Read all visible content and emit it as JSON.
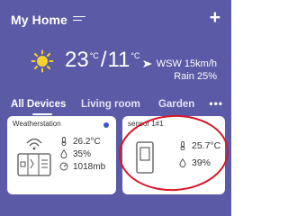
{
  "header": {
    "title": "My Home"
  },
  "weather": {
    "temperature": "23",
    "temp_unit": "°C",
    "temperature_2": "11",
    "temp_unit_2": "°C",
    "wind": "WSW 15km/h",
    "rain": "Rain 25%"
  },
  "tabs": [
    {
      "label": "All Devices"
    },
    {
      "label": "Living room"
    },
    {
      "label": "Garden"
    }
  ],
  "devices": [
    {
      "name": "Weatherstation",
      "temperature": "26.2°C",
      "humidity": "35%",
      "pressure": "1018mb",
      "status_color": "#3a56c9"
    },
    {
      "name": "sensor 1#1",
      "temperature": "25.7°C",
      "humidity": "39%"
    }
  ],
  "colors": {
    "background": "#5a5aa6",
    "card": "#ffffff",
    "highlight": "#d9162a",
    "sun": "#f6d22a"
  },
  "icons": [
    "menu-icon",
    "plus-icon",
    "sun-icon",
    "navigation-arrow-icon",
    "more-icon",
    "thermometer-icon",
    "humidity-icon",
    "pressure-icon",
    "weatherstation-device-icon",
    "sensor-device-icon"
  ]
}
